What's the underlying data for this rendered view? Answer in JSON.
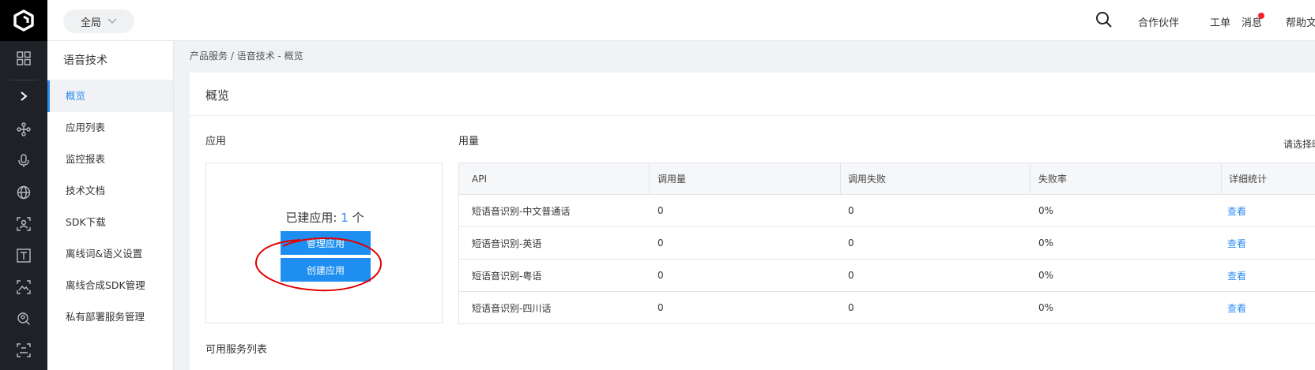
{
  "topbar": {
    "region_label": "全局",
    "links": {
      "partners": "合作伙伴",
      "tickets": "工单",
      "messages": "消息",
      "help": "帮助文"
    }
  },
  "sidebar": {
    "title": "语音技术",
    "items": [
      {
        "label": "概览"
      },
      {
        "label": "应用列表"
      },
      {
        "label": "监控报表"
      },
      {
        "label": "技术文档"
      },
      {
        "label": "SDK下载"
      },
      {
        "label": "离线词&语义设置"
      },
      {
        "label": "离线合成SDK管理"
      },
      {
        "label": "私有部署服务管理"
      }
    ]
  },
  "breadcrumb": "产品服务 / 语音技术 - 概览",
  "main": {
    "title": "概览",
    "apps": {
      "label": "应用",
      "count_prefix": "已建应用: ",
      "count": "1",
      "count_suffix": " 个",
      "manage_button": "管理应用",
      "create_button": "创建应用"
    },
    "usage": {
      "label": "用量",
      "date_hint": "请选择时",
      "headers": [
        "API",
        "调用量",
        "调用失败",
        "失败率",
        "详细统计"
      ],
      "rows": [
        {
          "api": "短语音识别-中文普通话",
          "calls": "0",
          "failures": "0",
          "rate": "0%",
          "action": "查看"
        },
        {
          "api": "短语音识别-英语",
          "calls": "0",
          "failures": "0",
          "rate": "0%",
          "action": "查看"
        },
        {
          "api": "短语音识别-粤语",
          "calls": "0",
          "failures": "0",
          "rate": "0%",
          "action": "查看"
        },
        {
          "api": "短语音识别-四川话",
          "calls": "0",
          "failures": "0",
          "rate": "0%",
          "action": "查看"
        }
      ]
    },
    "services_label": "可用服务列表"
  },
  "colors": {
    "accent": "#2d8cf0",
    "button": "#1e8ff0",
    "rail": "#1f2126",
    "annotation": "#e00000"
  }
}
